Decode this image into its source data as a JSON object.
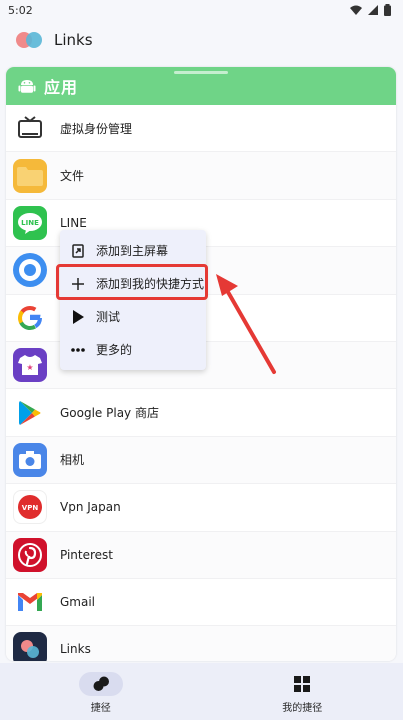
{
  "status_bar": {
    "time": "5:02"
  },
  "app_bar": {
    "title": "Links"
  },
  "card": {
    "title": "应用",
    "header_color": "#6fd487"
  },
  "apps": [
    {
      "label": "虚拟身份管理",
      "icon": "tv-icon"
    },
    {
      "label": "文件",
      "icon": "folder-icon"
    },
    {
      "label": "LINE",
      "icon": "line-icon"
    },
    {
      "label": "",
      "icon": "blue-circle-app-icon"
    },
    {
      "label": "",
      "icon": "google-icon"
    },
    {
      "label": "",
      "icon": "tshirt-star-icon"
    },
    {
      "label": "Google Play 商店",
      "icon": "play-store-icon"
    },
    {
      "label": "相机",
      "icon": "camera-icon"
    },
    {
      "label": "Vpn Japan",
      "icon": "vpn-icon"
    },
    {
      "label": "Pinterest",
      "icon": "pinterest-icon"
    },
    {
      "label": "Gmail",
      "icon": "gmail-icon"
    },
    {
      "label": "Links",
      "icon": "links-icon"
    }
  ],
  "context_menu": {
    "items": [
      {
        "label": "添加到主屏幕",
        "icon": "add-to-home-icon"
      },
      {
        "label": "添加到我的快捷方式",
        "icon": "plus-icon"
      },
      {
        "label": "测试",
        "icon": "play-icon"
      },
      {
        "label": "更多的",
        "icon": "more-dots-icon"
      }
    ]
  },
  "bottom_nav": {
    "items": [
      {
        "label": "捷径",
        "icon": "shortcut-dots-icon",
        "active": true
      },
      {
        "label": "我的捷径",
        "icon": "grid-icon",
        "active": false
      }
    ]
  },
  "colors": {
    "highlight": "#e53935",
    "menu_bg": "#eef0fb",
    "nav_bg": "#eceef8"
  }
}
